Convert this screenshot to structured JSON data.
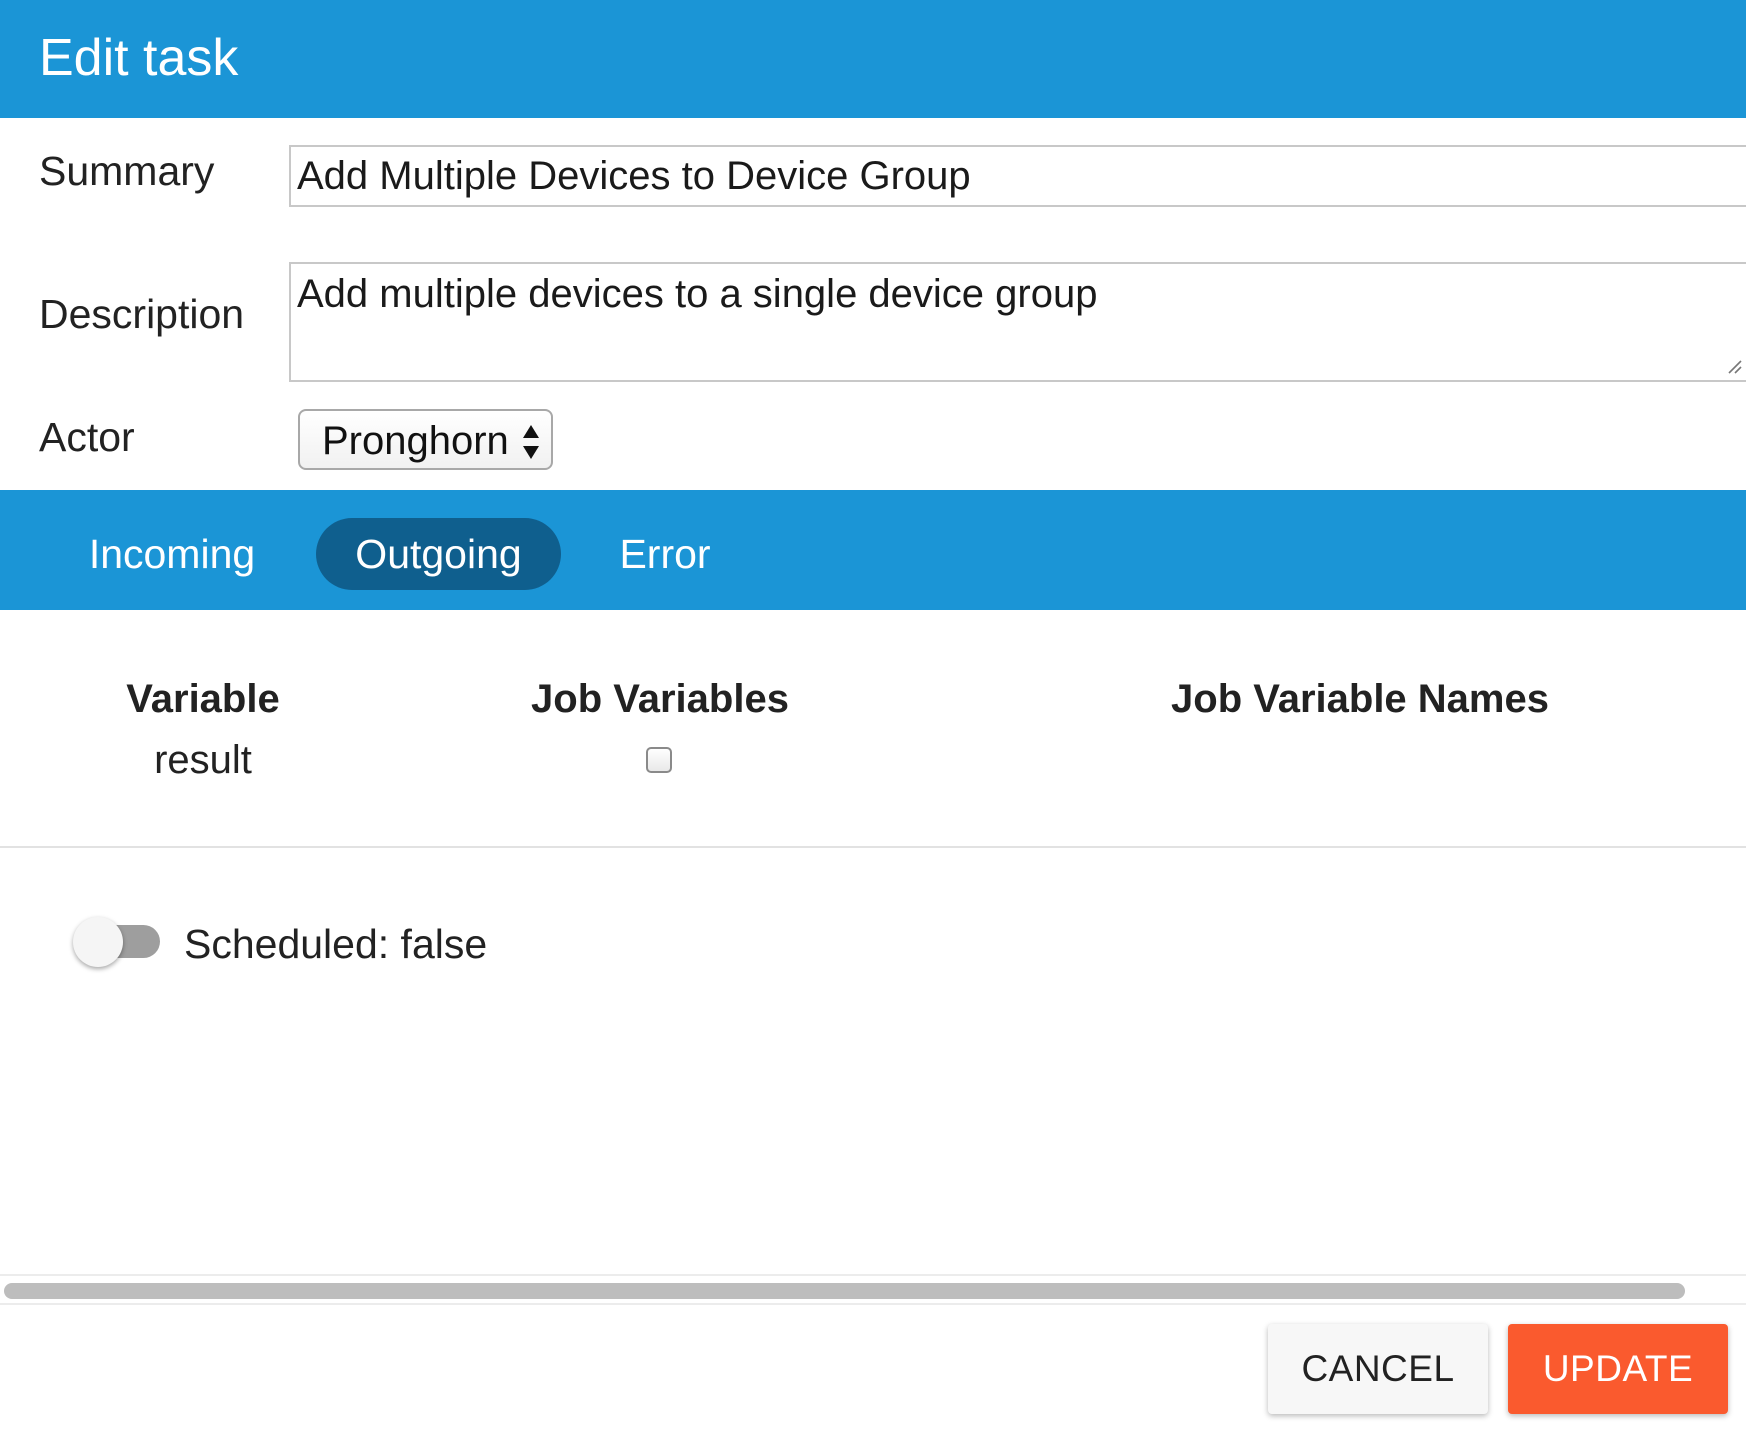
{
  "dialog": {
    "title": "Edit task"
  },
  "form": {
    "summary_label": "Summary",
    "summary_value": "Add Multiple Devices to Device Group",
    "description_label": "Description",
    "description_value": "Add multiple devices to a single device group",
    "actor_label": "Actor",
    "actor_value": "Pronghorn"
  },
  "tabs": [
    {
      "label": "Incoming",
      "active": false
    },
    {
      "label": "Outgoing",
      "active": true
    },
    {
      "label": "Error",
      "active": false
    }
  ],
  "table": {
    "headers": [
      "Variable",
      "Job Variables",
      "Job Variable Names"
    ],
    "rows": [
      {
        "variable": "result",
        "job_variable_checked": false,
        "job_variable_name": ""
      }
    ]
  },
  "scheduled": {
    "label": "Scheduled: false",
    "on": false
  },
  "buttons": {
    "cancel": "CANCEL",
    "update": "UPDATE"
  },
  "colors": {
    "header_blue": "#1b95d6",
    "active_tab": "#0f5f8e",
    "update_button": "#fa5a2e"
  },
  "icons": {
    "select_arrows": "select-arrows-icon",
    "resize_grip": "resize-grip-icon"
  }
}
